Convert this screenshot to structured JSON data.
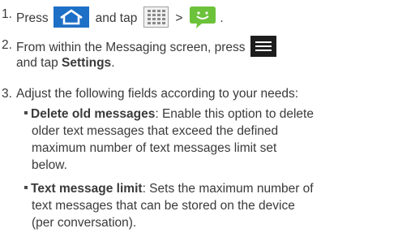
{
  "steps": [
    {
      "number": "1.",
      "parts": [
        "Press",
        "and tap",
        ">",
        "."
      ]
    },
    {
      "number": "2.",
      "line1": "From within the Messaging screen, press",
      "line2_prefix": "and tap ",
      "line2_bold": "Settings",
      "line2_suffix": "."
    },
    {
      "number": "3.",
      "line1": "Adjust the following fields according to your needs:"
    }
  ],
  "options": [
    {
      "term": "Delete old messages",
      "line1_rest": ": Enable this option to delete",
      "lines": [
        "older text messages that exceed the defined",
        "maximum number of text messages limit set",
        "below."
      ]
    },
    {
      "term": "Text message limit",
      "line1_rest": ": Sets the maximum number of",
      "lines": [
        "text messages that can be stored on the device",
        "(per conversation)."
      ]
    }
  ],
  "icons": {
    "home": "home-icon",
    "apps": "apps-grid-icon",
    "messaging": "messaging-icon",
    "menu": "menu-icon"
  },
  "colors": {
    "text": "#3a3a3a",
    "icon_blue": "#1e6fc6",
    "messaging_green": "#6cc23a"
  }
}
